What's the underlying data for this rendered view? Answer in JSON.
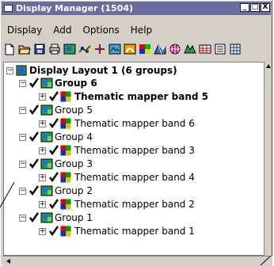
{
  "window": {
    "title": "Display Manager (1504)",
    "controls": [
      "_",
      "□",
      "X"
    ]
  },
  "menu": [
    "Display",
    "Add",
    "Options",
    "Help"
  ],
  "toolbar_icons": [
    "new-document-icon",
    "open-folder-icon",
    "save-icon",
    "print-icon",
    "add-raster-icon",
    "add-vector-icon",
    "add-point-icon",
    "add-cad-icon",
    "add-shape-icon",
    "add-color-icon",
    "add-tin-icon",
    "add-grid-icon",
    "add-region-icon",
    "add-database-icon",
    "add-legend-icon",
    "add-table-icon"
  ],
  "tree": {
    "root": "Display Layout 1  (6 groups)",
    "groups": [
      {
        "name": "Group 6",
        "layer": "Thematic mapper band 5",
        "bold": true
      },
      {
        "name": "Group 5",
        "layer": "Thematic mapper band 6",
        "bold": false
      },
      {
        "name": "Group 4",
        "layer": "Thematic mapper band 3",
        "bold": false
      },
      {
        "name": "Group 3",
        "layer": "Thematic mapper band 4",
        "bold": false
      },
      {
        "name": "Group 2",
        "layer": "Thematic mapper band 2",
        "bold": false
      },
      {
        "name": "Group 1",
        "layer": "Thematic mapper band 1",
        "bold": false
      }
    ]
  },
  "colors": {
    "title_bar": "#6a6d9e",
    "window_bg": "#d4d0c8",
    "check": "#000000"
  }
}
